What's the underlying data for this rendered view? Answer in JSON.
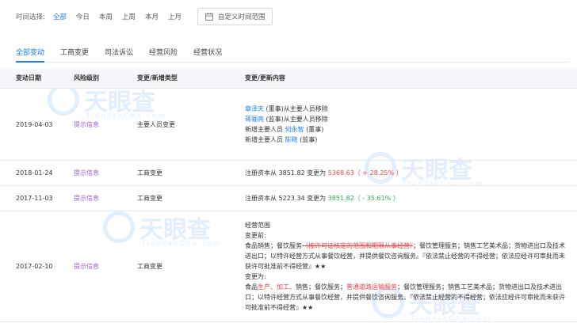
{
  "filter": {
    "label": "时间选择:",
    "options": [
      "全部",
      "今日",
      "本周",
      "上周",
      "本月",
      "上月"
    ],
    "custom_range": "自定义时间范围"
  },
  "tabs": [
    "全部变动",
    "工商变更",
    "司法诉讼",
    "经营风险",
    "经营状况"
  ],
  "table": {
    "headers": [
      "变动日期",
      "风险级别",
      "变更/新增类型",
      "变更/更新内容"
    ],
    "rows": [
      {
        "date": "2019-04-03",
        "risk": "提示信息",
        "type": "主要人员变更",
        "lines": [
          {
            "name": "章泽天",
            "text": " (董事)从主要人员移除"
          },
          {
            "name": "蒋骊亮",
            "text": " (监事)从主要人员移除"
          },
          {
            "prefix": "新增主要人员 ",
            "name": "何永智",
            "text": " (董事)"
          },
          {
            "prefix": "新增主要人员 ",
            "name": "陈晓",
            "text": " (监事)"
          }
        ]
      },
      {
        "date": "2018-01-24",
        "risk": "提示信息",
        "type": "工商变更",
        "capital_from": "注册资本从 3851.82 变更为 ",
        "capital_to": "5368.63",
        "capital_change": "（ + 28.25% ）"
      },
      {
        "date": "2017-11-03",
        "risk": "提示信息",
        "type": "工商变更",
        "capital_from": "注册资本从 5223.34 变更为 ",
        "capital_to": "3851.82",
        "capital_change": "（ - 35.61% ）"
      },
      {
        "date": "2017-02-10",
        "risk": "提示信息",
        "type": "工商变更",
        "scope_title": "经营范围",
        "before_label": "变更前:",
        "before_a": "食品销售；餐饮服务",
        "before_strike": "（按许可证核定的范围和期限从事经营）",
        "before_b": "；餐饮管理服务；销售工艺美术品；货物进出口及技术进出口；以特许经营方式从事餐饮经营，并提供餐饮咨询服务。『依法禁止经营的不得经营；依法应经许可审批而未获许可批准前不得经营』★★",
        "after_label": "变更为:",
        "after_a": "食品",
        "after_red1": "生产、加工、",
        "after_b": "销售；餐饮服务；",
        "after_red2": "普通道路运输服务",
        "after_c": "；餐饮管理服务；销售工艺美术品；货物进出口及技术进出口；以特许经营方式从事餐饮经营，并提供餐饮咨询服务。『依法禁止经营的不得经营；依法应经许可审批而未获许可批准前不得经营』★★"
      }
    ]
  },
  "watermark": {
    "brand": "天眼查",
    "domain": "TianYanCha.com"
  },
  "colors": {
    "accent": "#1a7ff0",
    "risk": "#a259d9",
    "increase": "#e54545",
    "decrease": "#2bb24c"
  }
}
